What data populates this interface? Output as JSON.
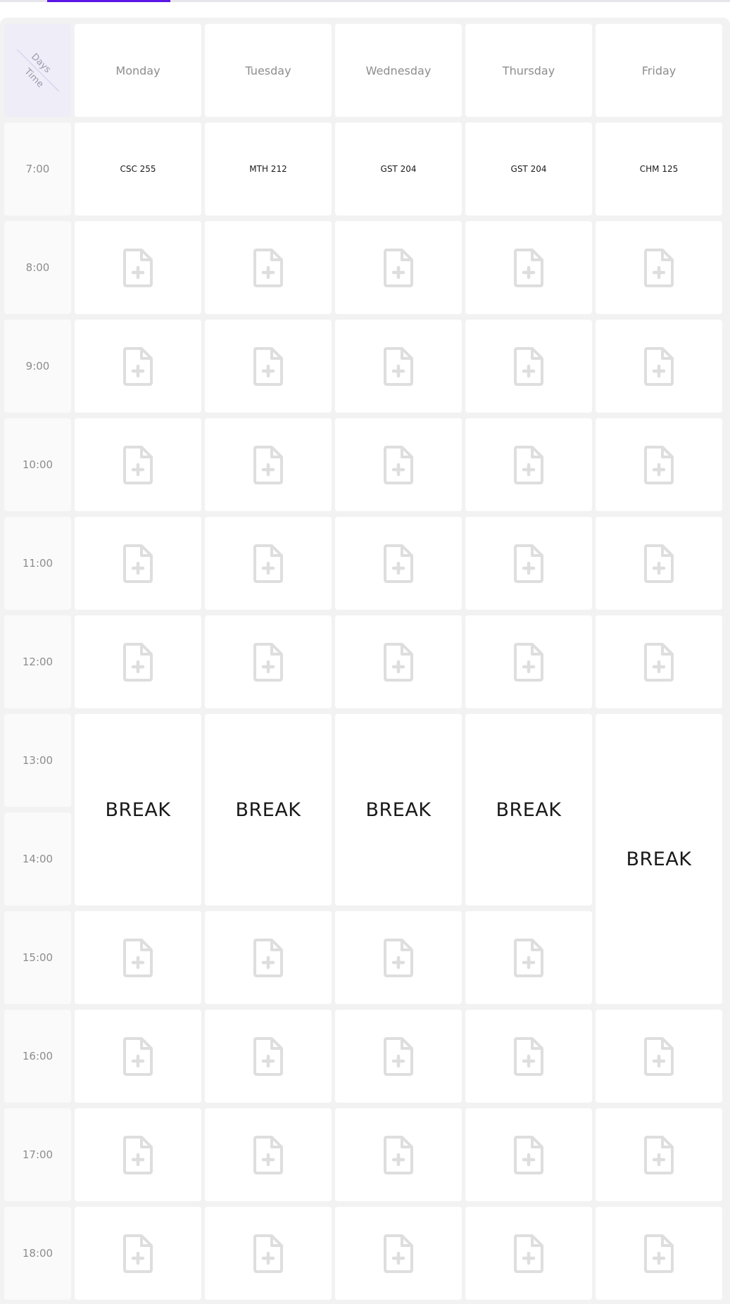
{
  "header_label": {
    "days": "Days",
    "time": "Time"
  },
  "days": [
    "Monday",
    "Tuesday",
    "Wednesday",
    "Thursday",
    "Friday"
  ],
  "times": [
    "7:00",
    "8:00",
    "9:00",
    "10:00",
    "11:00",
    "12:00",
    "13:00",
    "14:00",
    "15:00",
    "16:00",
    "17:00",
    "18:00"
  ],
  "courses_7am": [
    "CSC 255",
    "MTH 212",
    "GST 204",
    "GST 204",
    "CHM 125"
  ],
  "break_label": "BREAK",
  "colors": {
    "accent": "#5b16e6",
    "icon": "#dedede",
    "background": "#f2f2f2"
  },
  "icon": "add-file-icon"
}
